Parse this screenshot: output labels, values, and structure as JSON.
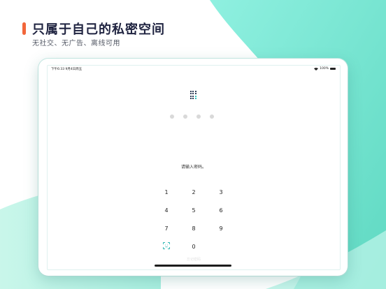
{
  "promo": {
    "title": "只属于自己的私密空间",
    "subtitle": "无社交、无广告、离线可用",
    "accent_color": "#f2663a",
    "bg_teal": "#7ee6d2"
  },
  "status_bar": {
    "time_date": "下午6:33   9月4日周五",
    "battery": "100%"
  },
  "lock_screen": {
    "app_icon": "grid-logo-icon",
    "passcode_dots": 4,
    "prompt": "请输入密码。",
    "keys": [
      "1",
      "2",
      "3",
      "4",
      "5",
      "6",
      "7",
      "8",
      "9",
      "0"
    ],
    "scan_icon": "face-scan-icon",
    "ghost_text": "忘记密码"
  }
}
